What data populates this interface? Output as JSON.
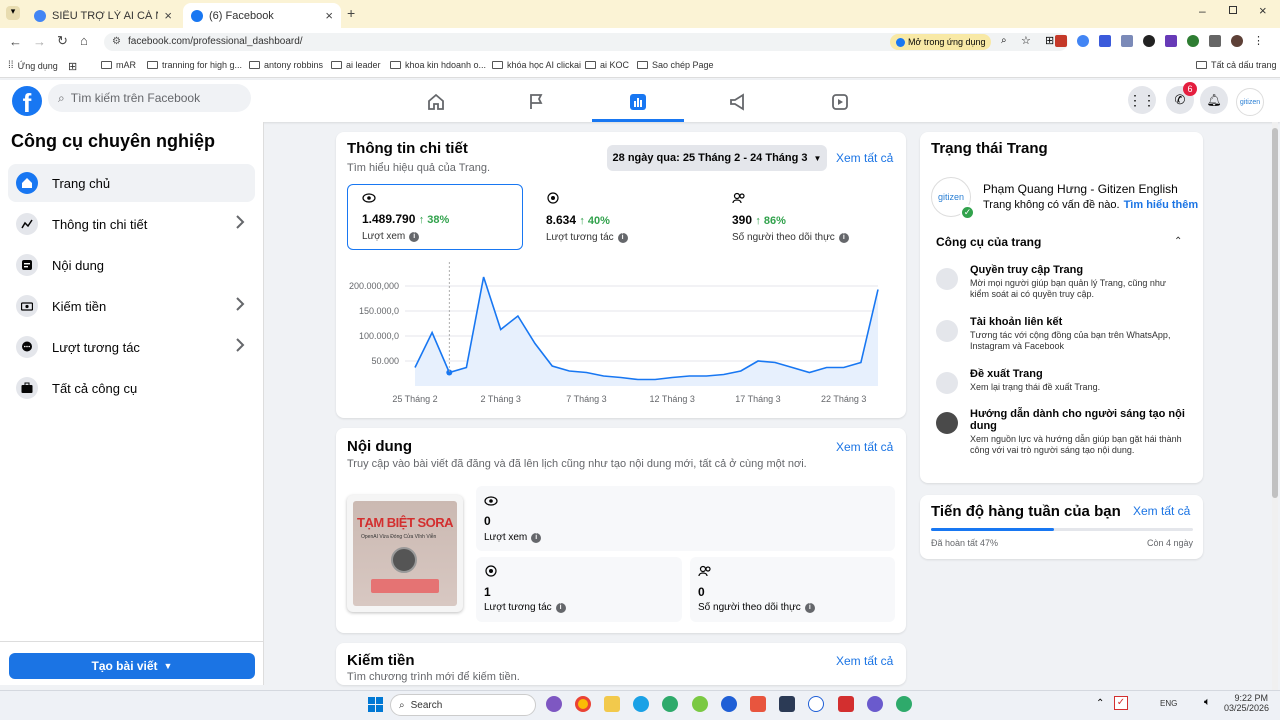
{
  "browser": {
    "tabs": [
      {
        "title": "SIÊU TRỢ LÝ AI CÁ NHÂN - Mu"
      },
      {
        "title": "(6) Facebook"
      }
    ],
    "url": "facebook.com/professional_dashboard/",
    "open_in_app": "Mở trong ứng dụng",
    "bookmarks": [
      "Ứng dụng",
      "mAR",
      "tranning for high g...",
      "antony robbins",
      "ai leader",
      "khoa kin hdoanh o...",
      "khóa học AI clickai",
      "ai KOC",
      "Sao chép Page"
    ],
    "bookmarks_right": "Tất cả dấu trang"
  },
  "header": {
    "search_placeholder": "Tìm kiếm trên Facebook",
    "messenger_badge": "6"
  },
  "sidebar": {
    "title": "Công cụ chuyên nghiệp",
    "items": [
      {
        "label": "Trang chủ"
      },
      {
        "label": "Thông tin chi tiết"
      },
      {
        "label": "Nội dung"
      },
      {
        "label": "Kiếm tiền"
      },
      {
        "label": "Lượt tương tác"
      },
      {
        "label": "Tất cả công cụ"
      }
    ],
    "create_button": "Tạo bài viết"
  },
  "insights": {
    "title": "Thông tin chi tiết",
    "subtitle": "Tìm hiểu hiệu quả của Trang.",
    "date_range": "28 ngày qua: 25 Tháng 2 - 24 Tháng 3",
    "see_all": "Xem tất cả",
    "metrics": [
      {
        "value": "1.489.790",
        "change": "↑ 38%",
        "label": "Lượt xem"
      },
      {
        "value": "8.634",
        "change": "↑ 40%",
        "label": "Lượt tương tác"
      },
      {
        "value": "390",
        "change": "↑ 86%",
        "label": "Số người theo dõi thực"
      }
    ]
  },
  "chart_data": {
    "type": "area",
    "y_ticks": [
      "50.000",
      "100.000,0",
      "150.000,0",
      "200.000,000"
    ],
    "x_ticks": [
      "25 Tháng 2",
      "2 Tháng 3",
      "7 Tháng 3",
      "12 Tháng 3",
      "17 Tháng 3",
      "22 Tháng 3"
    ],
    "ylim": [
      0,
      220000
    ],
    "x": [
      "25 Tháng 2",
      "26 Tháng 2",
      "27 Tháng 2",
      "28 Tháng 2",
      "1 Tháng 3",
      "2 Tháng 3",
      "3 Tháng 3",
      "4 Tháng 3",
      "5 Tháng 3",
      "6 Tháng 3",
      "7 Tháng 3",
      "8 Tháng 3",
      "9 Tháng 3",
      "10 Tháng 3",
      "11 Tháng 3",
      "12 Tháng 3",
      "13 Tháng 3",
      "14 Tháng 3",
      "15 Tháng 3",
      "16 Tháng 3",
      "17 Tháng 3",
      "18 Tháng 3",
      "19 Tháng 3",
      "20 Tháng 3",
      "21 Tháng 3",
      "22 Tháng 3",
      "23 Tháng 3",
      "24 Tháng 3"
    ],
    "values": [
      37000,
      107000,
      27000,
      37000,
      218000,
      113000,
      140000,
      85000,
      40000,
      30000,
      27000,
      20000,
      17000,
      13000,
      13000,
      17000,
      20000,
      20000,
      23000,
      30000,
      50000,
      47000,
      37000,
      27000,
      37000,
      37000,
      47000,
      193000
    ],
    "series_color": "#1877f2",
    "fill_color": "#e7f0fd",
    "grid": true
  },
  "content": {
    "title": "Nội dung",
    "see_all": "Xem tất cả",
    "subtitle": "Truy cập vào bài viết đã đăng và đã lên lịch cũng như tạo nội dung mới, tất cả ở cùng một nơi.",
    "thumb_title": "TẠM BIỆT SORA",
    "thumb_sub": "OpenAI Vừa Đóng Cửa Vĩnh Viễn",
    "stats": [
      {
        "value": "0",
        "label": "Lượt xem"
      },
      {
        "value": "1",
        "label": "Lượt tương tác"
      },
      {
        "value": "0",
        "label": "Số người theo dõi thực"
      }
    ]
  },
  "monetize": {
    "title": "Kiếm tiền",
    "see_all": "Xem tất cả",
    "subtitle": "Tìm chương trình mới để kiếm tiền."
  },
  "page_status": {
    "title": "Trạng thái Trang",
    "page_name": "Phạm Quang Hưng - Gitizen English",
    "status_text": "Trang không có vấn đề nào.",
    "learn_more": "Tìm hiểu thêm",
    "avatar_text": "gitizen",
    "tools_title": "Công cụ của trang",
    "tools": [
      {
        "name": "Quyền truy cập Trang",
        "desc": "Mời mọi người giúp bạn quản lý Trang, cũng như kiểm soát ai có quyền truy cập."
      },
      {
        "name": "Tài khoản liên kết",
        "desc": "Tương tác với cộng đồng của bạn trên WhatsApp, Instagram và Facebook"
      },
      {
        "name": "Đề xuất Trang",
        "desc": "Xem lại trạng thái đề xuất Trang."
      },
      {
        "name": "Hướng dẫn dành cho người sáng tạo nội dung",
        "desc": "Xem nguồn lực và hướng dẫn giúp bạn gặt hái thành công với vai trò người sáng tạo nội dung."
      }
    ]
  },
  "weekly": {
    "title": "Tiến độ hàng tuần của bạn",
    "see_all": "Xem tất cả",
    "done": "Đã hoàn tất 47%",
    "remaining": "Còn 4 ngày",
    "progress": 0.47
  },
  "taskbar": {
    "search": "Search",
    "lang": "ENG",
    "time": "9:22 PM",
    "date": "03/25/2026"
  }
}
